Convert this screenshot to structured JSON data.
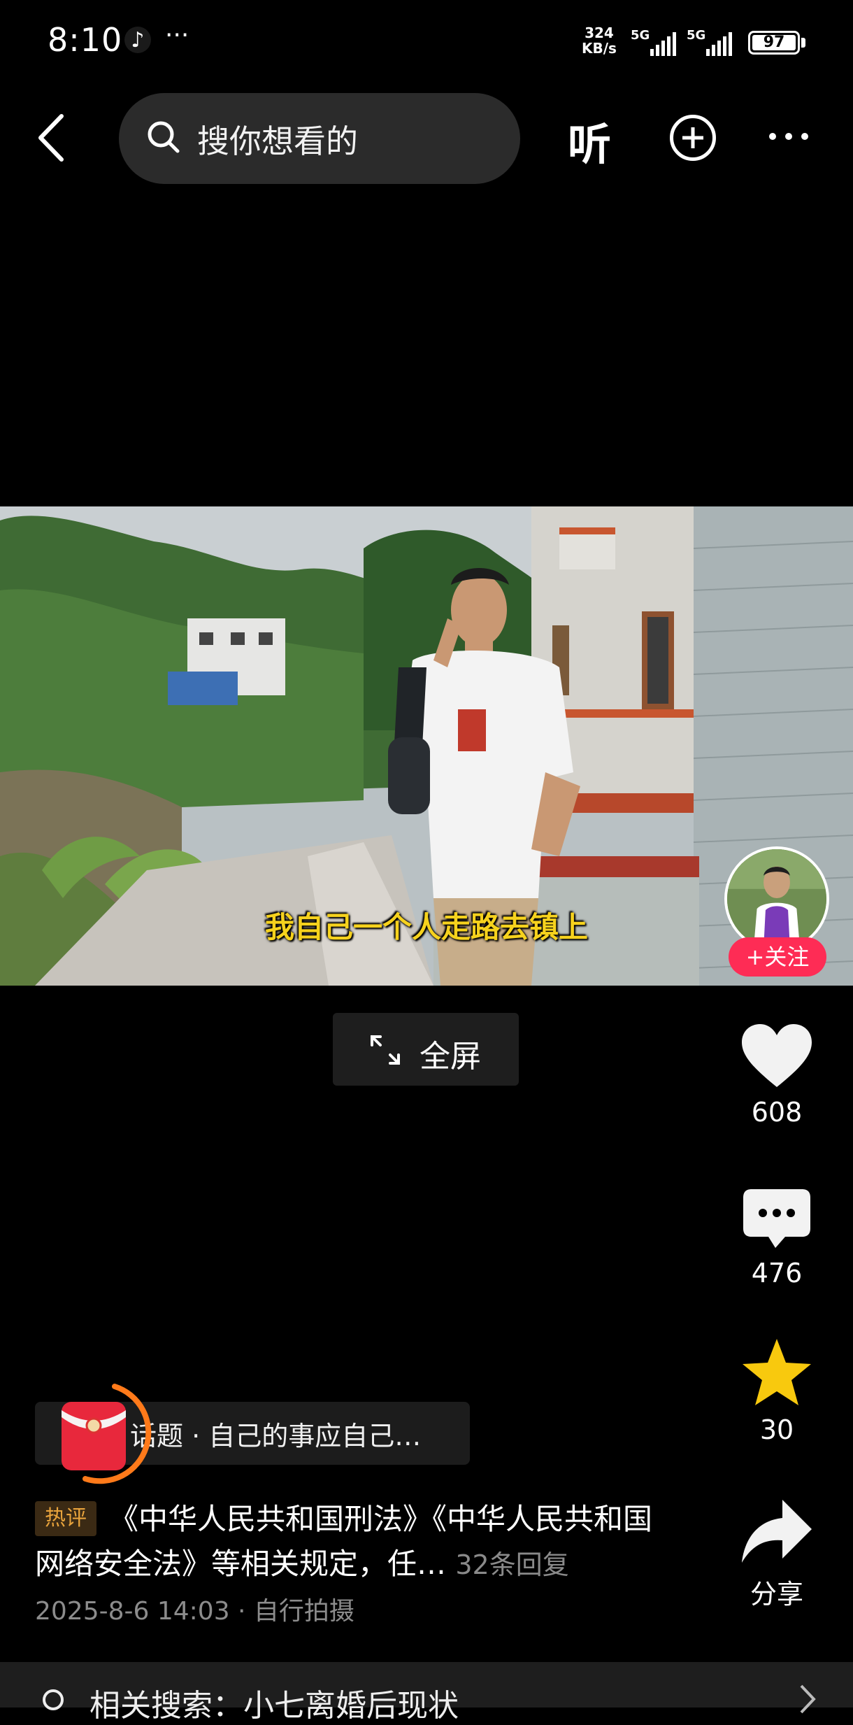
{
  "status_bar": {
    "time": "8:10",
    "speed_value": "324",
    "speed_unit": "KB/s",
    "signal1_label": "5G",
    "signal2_label": "5G",
    "battery": "97",
    "more": "···"
  },
  "top_nav": {
    "search_placeholder": "搜你想看的",
    "listen_label": "听"
  },
  "video": {
    "subtitle": "我自己一个人走路去镇上",
    "fullscreen_label": "全屏",
    "follow_label": "+关注"
  },
  "actions": {
    "likes": "608",
    "comments": "476",
    "favorites": "30",
    "share_label": "分享"
  },
  "info": {
    "topic": "话题 · 自己的事应自己…",
    "hot_badge": "热评",
    "comment": "《中华人民共和国刑法》《中华人民共和国网络安全法》等相关规定，任…",
    "reply_count": "32条回复",
    "meta": "2025-8-6 14:03 · 自行拍摄"
  },
  "related": {
    "text": "相关搜索：小七离婚后现状"
  },
  "colors": {
    "accent_red": "#fe2c55",
    "subtitle_yellow": "#f6d21d",
    "star_yellow": "#f8c90e",
    "hot_badge_text": "#e8a33c"
  }
}
